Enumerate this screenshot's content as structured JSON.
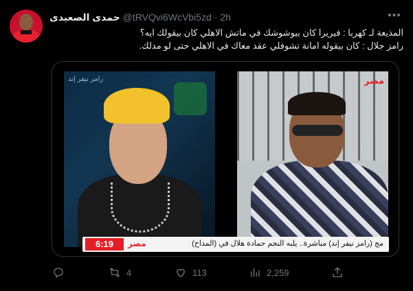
{
  "tweet": {
    "display_name": "حمدى الصعيدى",
    "handle": "@tRVQvi6WcVbi5zd",
    "separator": "·",
    "time": "2h",
    "text_lines": [
      "المذيعة لـ كهربا : فيريرا كان بيوشوشك في ماتش الاهلي كان بيقولك ايه؟",
      "رامز جلال : كان بيقوله امانة تشوفلي عقد معاك في الاهلي حتى لو مدلك."
    ]
  },
  "media": {
    "left_logo": "رامز نيفر إند",
    "right_logo": "مصر",
    "lower_third": {
      "time": "6:19",
      "logo": "مصر",
      "text": "مج (رامز نيفر إند) مباشرة.. يلبه النجم حمادة هلال في (المداح)"
    }
  },
  "actions": {
    "reply": "",
    "retweets": "4",
    "likes": "113",
    "views": "2,259"
  },
  "icons": {
    "more": "more-icon",
    "reply": "reply-icon",
    "retweet": "retweet-icon",
    "like": "heart-icon",
    "views": "views-icon",
    "share": "share-icon"
  }
}
